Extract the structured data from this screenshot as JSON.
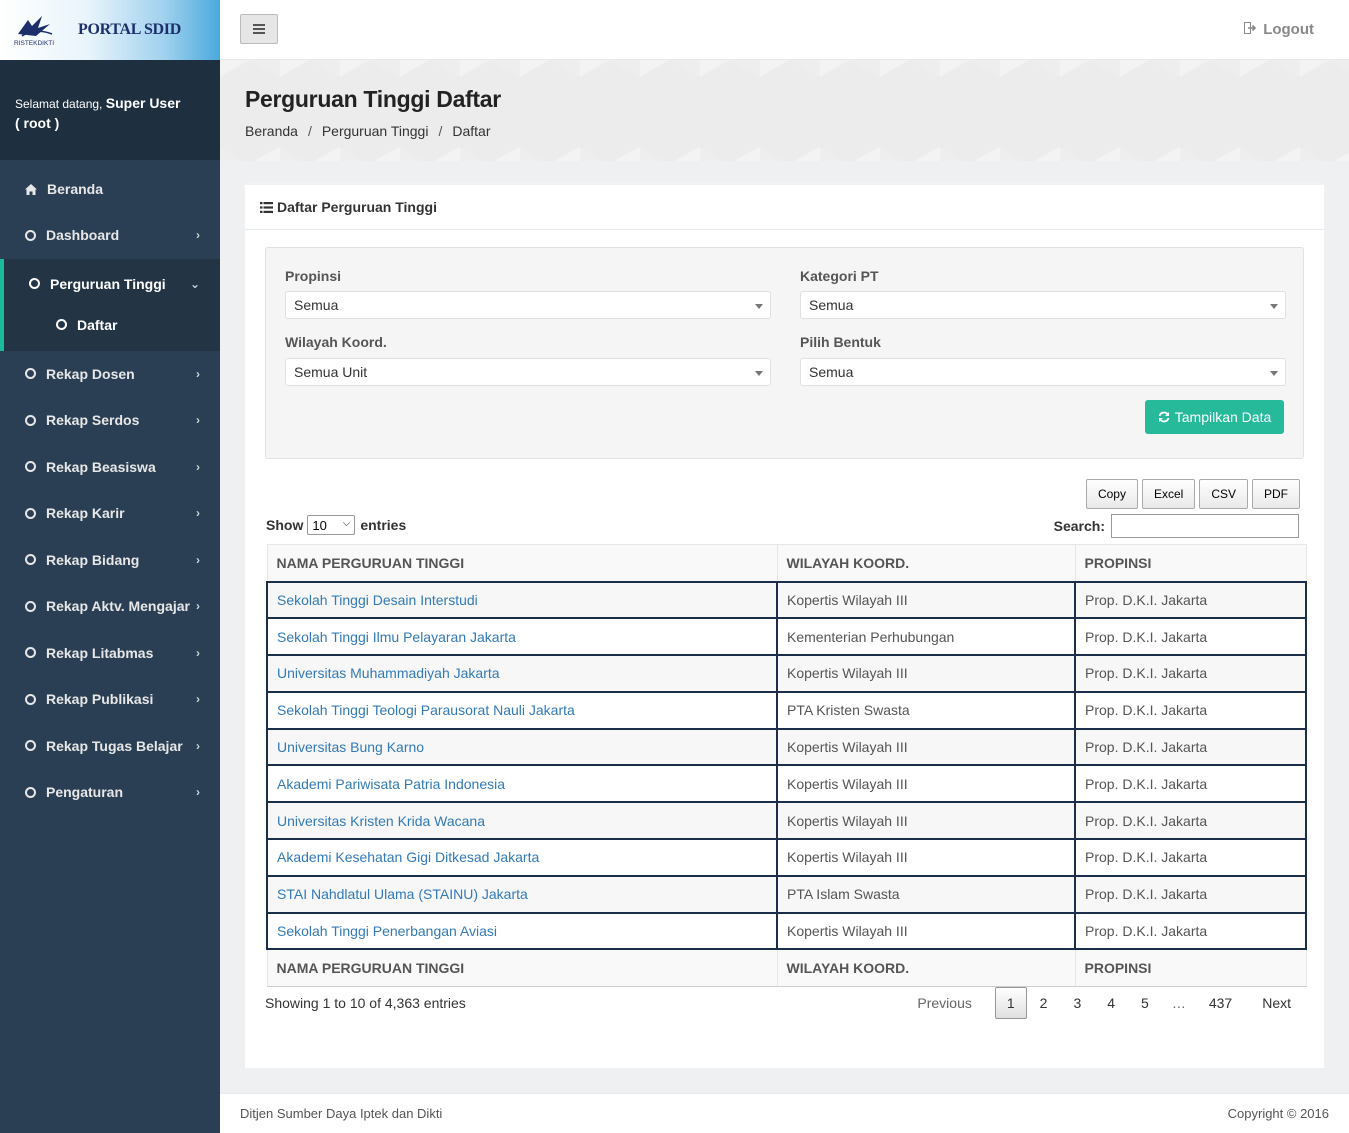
{
  "brand": {
    "title": "PORTAL SDID",
    "logo_text": "RISTEKDIKTI"
  },
  "welcome": {
    "greeting": "Selamat datang,",
    "user": "Super User",
    "login": "( root )"
  },
  "sidebar": {
    "home": "Beranda",
    "dashboard": "Dashboard",
    "active": {
      "label": "Perguruan Tinggi",
      "sub": "Daftar"
    },
    "items": [
      "Rekap Dosen",
      "Rekap Serdos",
      "Rekap Beasiswa",
      "Rekap Karir",
      "Rekap Bidang",
      "Rekap Aktv. Mengajar",
      "Rekap Litabmas",
      "Rekap Publikasi",
      "Rekap Tugas Belajar",
      "Pengaturan"
    ]
  },
  "topnav": {
    "logout": "Logout"
  },
  "page": {
    "title": "Perguruan Tinggi Daftar",
    "breadcrumb": [
      "Beranda",
      "Perguruan Tinggi",
      "Daftar"
    ],
    "breadcrumb_sep": "/"
  },
  "panel": {
    "title": "Daftar Perguruan Tinggi",
    "filters": {
      "propinsi": {
        "label": "Propinsi",
        "value": "Semua"
      },
      "kategori": {
        "label": "Kategori PT",
        "value": "Semua"
      },
      "wilayah": {
        "label": "Wilayah Koord.",
        "value": "Semua Unit"
      },
      "bentuk": {
        "label": "Pilih Bentuk",
        "value": "Semua"
      },
      "submit": "Tampilkan Data"
    },
    "exports": [
      "Copy",
      "Excel",
      "CSV",
      "PDF"
    ],
    "length": {
      "show": "Show",
      "value": "10",
      "entries": "entries"
    },
    "search_label": "Search:",
    "columns": [
      "NAMA PERGURUAN TINGGI",
      "WILAYAH KOORD.",
      "PROPINSI"
    ],
    "rows": [
      [
        "Sekolah Tinggi Desain Interstudi",
        "Kopertis Wilayah III",
        "Prop. D.K.I. Jakarta"
      ],
      [
        "Sekolah Tinggi Ilmu Pelayaran Jakarta",
        "Kementerian Perhubungan",
        "Prop. D.K.I. Jakarta"
      ],
      [
        "Universitas Muhammadiyah Jakarta",
        "Kopertis Wilayah III",
        "Prop. D.K.I. Jakarta"
      ],
      [
        "Sekolah Tinggi Teologi Parausorat Nauli Jakarta",
        "PTA Kristen Swasta",
        "Prop. D.K.I. Jakarta"
      ],
      [
        "Universitas Bung Karno",
        "Kopertis Wilayah III",
        "Prop. D.K.I. Jakarta"
      ],
      [
        "Akademi Pariwisata Patria Indonesia",
        "Kopertis Wilayah III",
        "Prop. D.K.I. Jakarta"
      ],
      [
        "Universitas Kristen Krida Wacana",
        "Kopertis Wilayah III",
        "Prop. D.K.I. Jakarta"
      ],
      [
        "Akademi Kesehatan Gigi Ditkesad Jakarta",
        "Kopertis Wilayah III",
        "Prop. D.K.I. Jakarta"
      ],
      [
        "STAI Nahdlatul Ulama (STAINU) Jakarta",
        "PTA Islam Swasta",
        "Prop. D.K.I. Jakarta"
      ],
      [
        "Sekolah Tinggi Penerbangan Aviasi",
        "Kopertis Wilayah III",
        "Prop. D.K.I. Jakarta"
      ]
    ],
    "info": "Showing 1 to 10 of 4,363 entries",
    "pagination": {
      "previous": "Previous",
      "pages": [
        "1",
        "2",
        "3",
        "4",
        "5"
      ],
      "ellipsis": "…",
      "last": "437",
      "next": "Next"
    }
  },
  "footer": {
    "left": "Ditjen Sumber Daya Iptek dan Dikti",
    "right": "Copyright © 2016"
  },
  "colors": {
    "sidebar": "#2a3f54",
    "accent": "#1abb9c",
    "button": "#26b99a",
    "link": "#337ab7"
  }
}
